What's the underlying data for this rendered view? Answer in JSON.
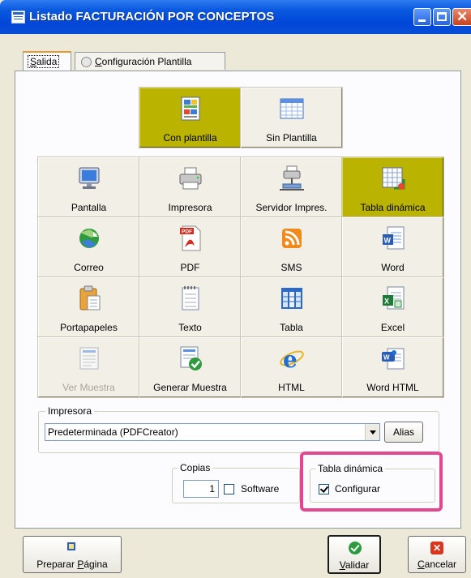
{
  "window": {
    "title": "Listado FACTURACIÓN POR CONCEPTOS"
  },
  "tabs": {
    "salida_prefix": "S",
    "salida_rest": "alida",
    "config_prefix": "C",
    "config_rest": "onfiguración Plantilla"
  },
  "template_buttons": {
    "con_plantilla": "Con plantilla",
    "sin_plantilla": "Sin Plantilla"
  },
  "output_grid": [
    [
      "Pantalla",
      "Impresora",
      "Servidor Impres.",
      "Tabla dinámica"
    ],
    [
      "Correo",
      "PDF",
      "SMS",
      "Word"
    ],
    [
      "Portapapeles",
      "Texto",
      "Tabla",
      "Excel"
    ],
    [
      "Ver Muestra",
      "Generar Muestra",
      "HTML",
      "Word HTML"
    ]
  ],
  "output_icons": [
    [
      "monitor-icon",
      "printer-icon",
      "print-server-icon",
      "pivot-table-icon"
    ],
    [
      "mail-icon",
      "pdf-icon",
      "sms-icon",
      "word-icon"
    ],
    [
      "clipboard-icon",
      "text-notepad-icon",
      "table-icon",
      "excel-icon"
    ],
    [
      "preview-icon",
      "generate-preview-icon",
      "html-ie-icon",
      "word-html-icon"
    ]
  ],
  "selected": {
    "template": "Con plantilla",
    "output": "Tabla dinámica"
  },
  "printer": {
    "group_label": "Impresora",
    "selected": "Predeterminada (PDFCreator)",
    "alias_button": "Alias"
  },
  "copies": {
    "group_label": "Copias",
    "value": "1",
    "software_label": "Software",
    "software_checked": false
  },
  "pivot": {
    "group_label": "Tabla dinámica",
    "configurar_label": "Configurar",
    "configurar_checked": true
  },
  "footer": {
    "preparar_prefix": "Preparar ",
    "preparar_u": "P",
    "preparar_rest": "ágina",
    "validar_u": "V",
    "validar_rest": "alidar",
    "cancelar_u": "C",
    "cancelar_rest": "ancelar"
  },
  "colors": {
    "selected_bg": "#bab400",
    "highlight": "#e3478f",
    "title_bar": "#0a58e0"
  }
}
